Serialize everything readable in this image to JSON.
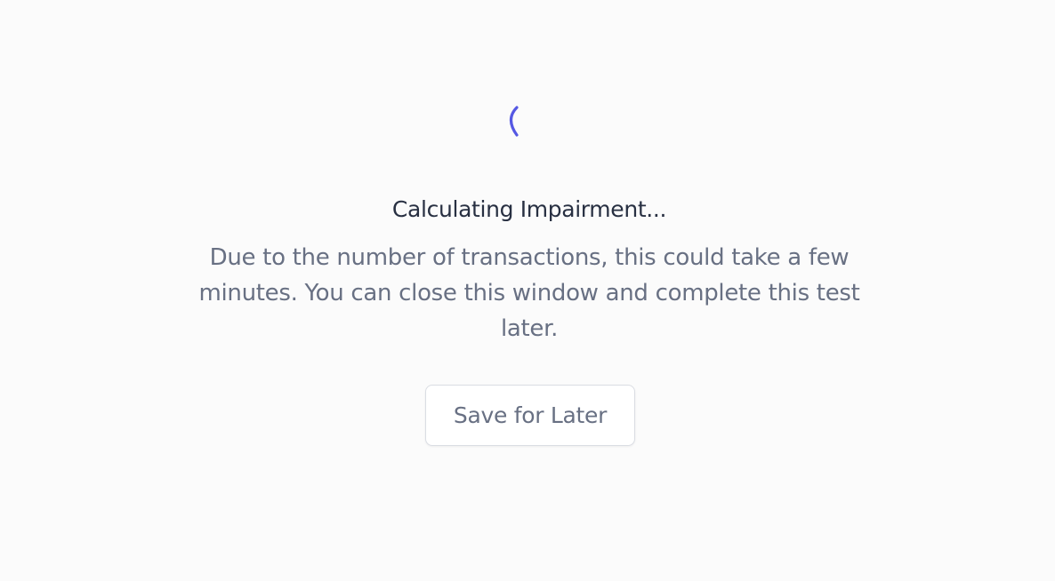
{
  "loader": {
    "icon": "loading-spinner-icon",
    "color": "#5558e3"
  },
  "status": {
    "title": "Calculating Impairment...",
    "description": "Due to the number of transactions, this could take a few minutes. You can close this window and complete this test later."
  },
  "actions": {
    "save_label": "Save for Later"
  }
}
